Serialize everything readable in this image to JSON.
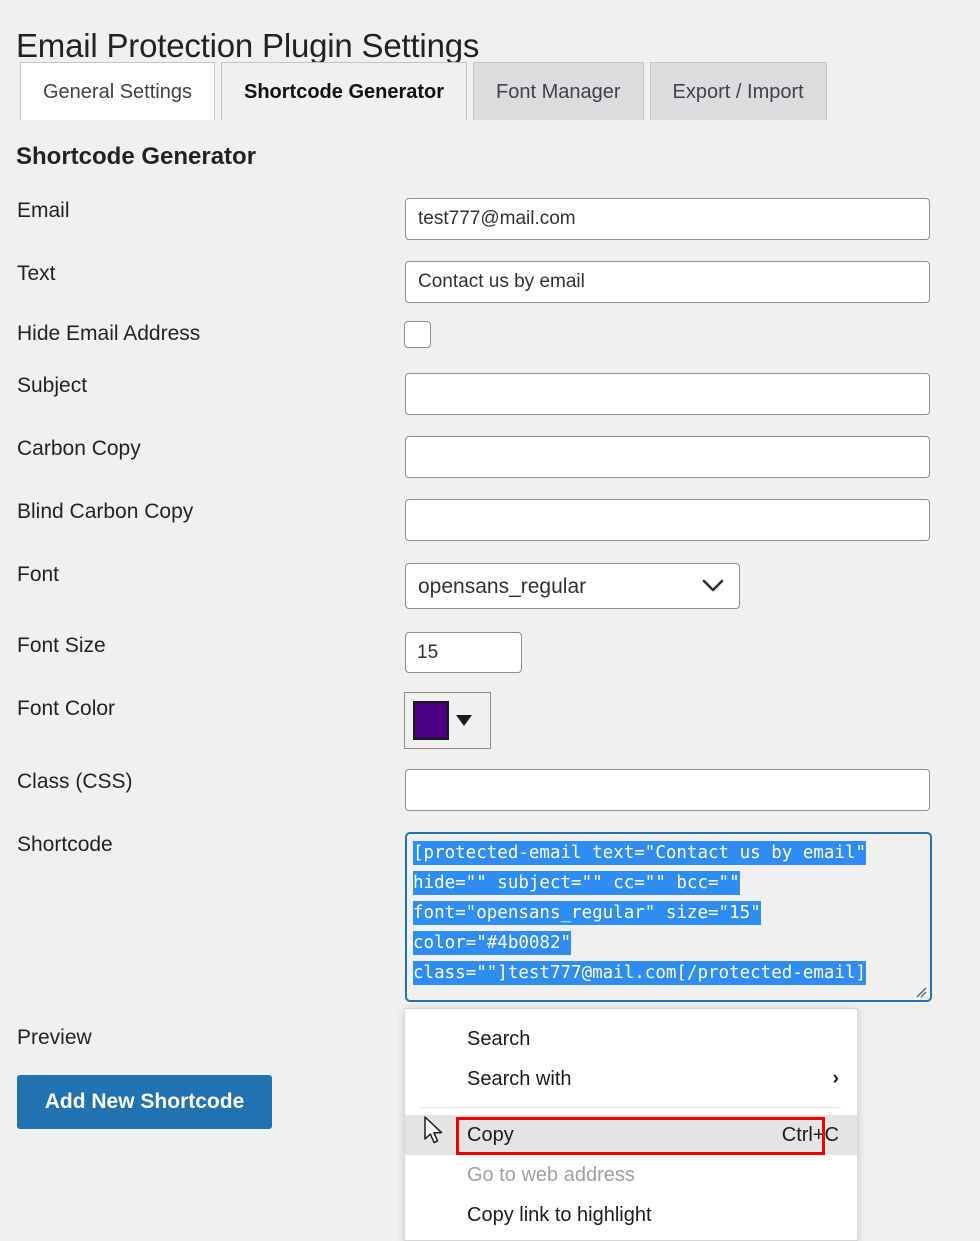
{
  "page": {
    "title": "Email Protection Plugin Settings",
    "section_title": "Shortcode Generator",
    "background_color": "#f0f0f1"
  },
  "tabs": [
    {
      "label": "General Settings",
      "state": "inactive-white"
    },
    {
      "label": "Shortcode Generator",
      "state": "active"
    },
    {
      "label": "Font Manager",
      "state": "inactive"
    },
    {
      "label": "Export / Import",
      "state": "inactive"
    }
  ],
  "form": {
    "email": {
      "label": "Email",
      "value": "test777@mail.com",
      "placeholder": ""
    },
    "text": {
      "label": "Text",
      "value": "Contact us by email",
      "placeholder": ""
    },
    "hide_email": {
      "label": "Hide Email Address",
      "checked": false
    },
    "subject": {
      "label": "Subject",
      "value": "",
      "placeholder": ""
    },
    "carbon_copy": {
      "label": "Carbon Copy",
      "value": "",
      "placeholder": ""
    },
    "blind_carbon_copy": {
      "label": "Blind Carbon Copy",
      "value": "",
      "placeholder": ""
    },
    "font": {
      "label": "Font",
      "value": "opensans_regular",
      "options": [
        "opensans_regular"
      ]
    },
    "font_size": {
      "label": "Font Size",
      "value": "15",
      "placeholder": ""
    },
    "font_color": {
      "label": "Font Color",
      "value": "#4b0082"
    },
    "class_css": {
      "label": "Class (CSS)",
      "value": "",
      "placeholder": ""
    },
    "shortcode": {
      "label": "Shortcode",
      "lines": [
        "[protected-email text=\"Contact us by email\"",
        "hide=\"\" subject=\"\" cc=\"\" bcc=\"\"",
        "font=\"opensans_regular\" size=\"15\"",
        "color=\"#4b0082\"",
        "class=\"\"]test777@mail.com[/protected-email]"
      ],
      "selection_color": "#2f8cf0",
      "border_color": "#2271b1"
    },
    "preview": {
      "label": "Preview"
    }
  },
  "actions": {
    "add_new_shortcode": {
      "label": "Add New Shortcode",
      "color": "#2271b1"
    }
  },
  "context_menu": {
    "items": [
      {
        "label": "Search",
        "shortcut": "",
        "state": "normal",
        "submenu": false
      },
      {
        "label": "Search with",
        "shortcut": "",
        "state": "normal",
        "submenu": true
      },
      {
        "label": "Copy",
        "shortcut": "Ctrl+C",
        "state": "highlight",
        "submenu": false
      },
      {
        "label": "Go to web address",
        "shortcut": "",
        "state": "disabled",
        "submenu": false
      },
      {
        "label": "Copy link to highlight",
        "shortcut": "",
        "state": "normal",
        "submenu": false
      }
    ],
    "highlight_outline_color": "#ee0000"
  }
}
